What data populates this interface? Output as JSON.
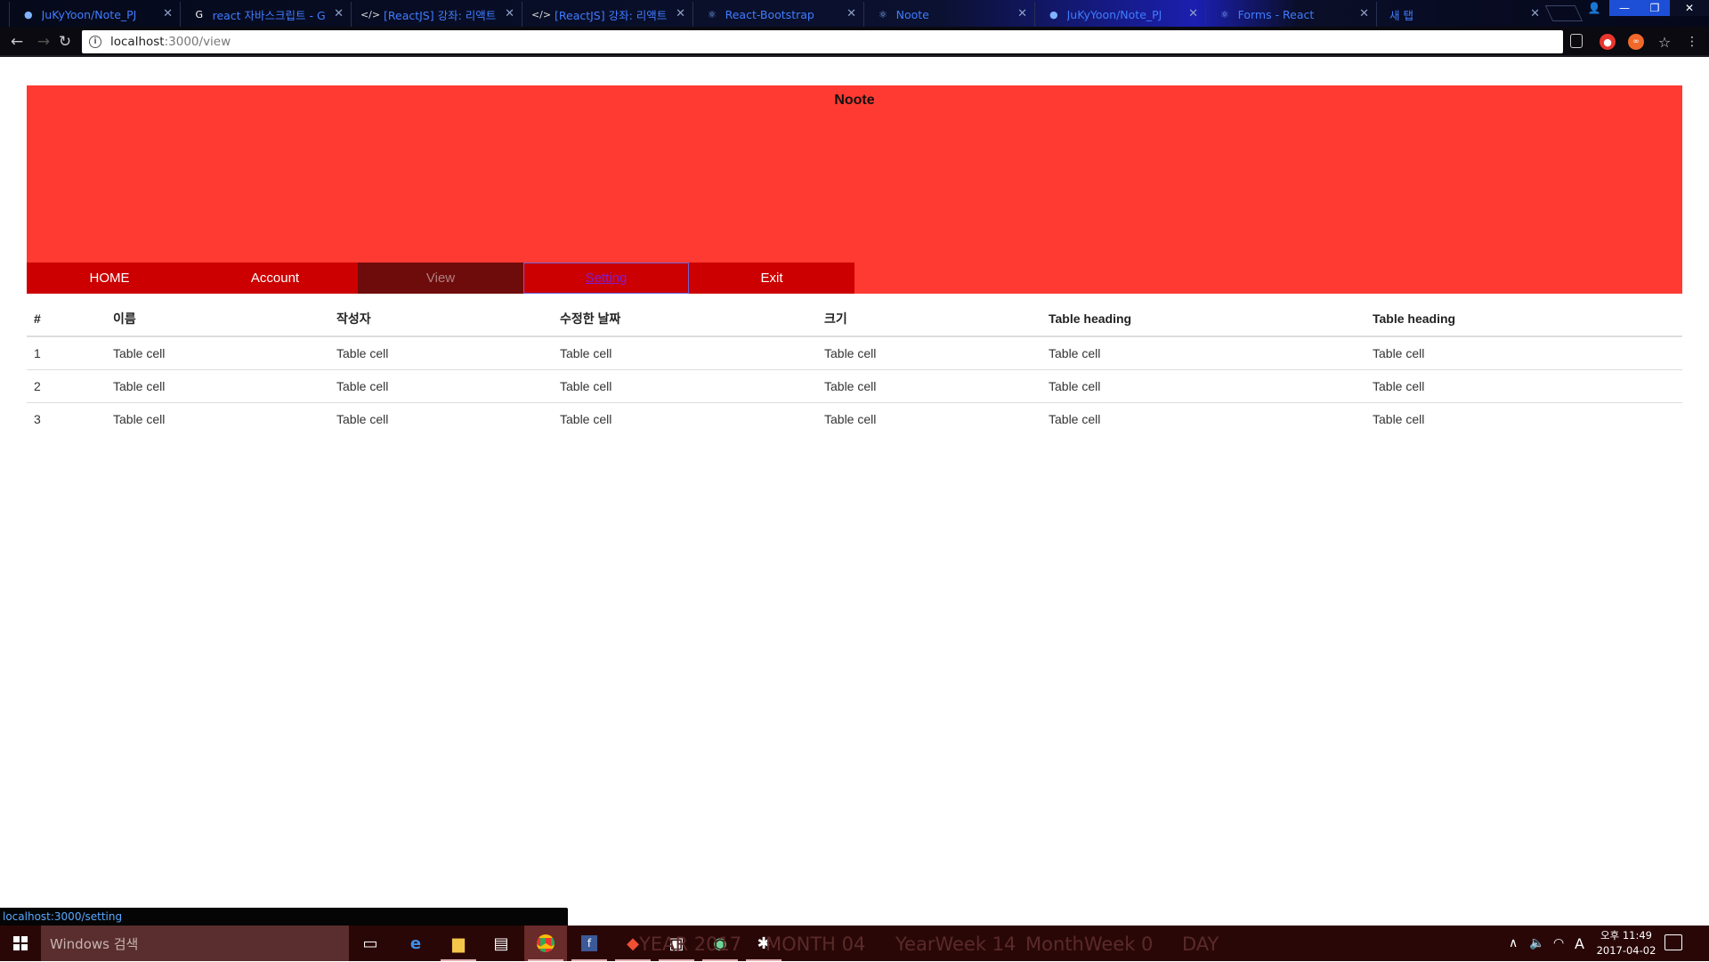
{
  "browser": {
    "tabs": [
      {
        "title": "JuKyYoon/Note_PJ",
        "favicon": "github-icon",
        "active": false
      },
      {
        "title": "react 자바스크립트 - G",
        "favicon": "google-icon",
        "active": false
      },
      {
        "title": "[ReactJS] 강좌: 리액트",
        "favicon": "velopert-icon",
        "active": false
      },
      {
        "title": "[ReactJS] 강좌: 리액트",
        "favicon": "velopert-icon",
        "active": false
      },
      {
        "title": "React-Bootstrap",
        "favicon": "react-icon",
        "active": false
      },
      {
        "title": "Noote",
        "favicon": "react-icon",
        "active": true
      },
      {
        "title": "JuKyYoon/Note_PJ",
        "favicon": "github-icon",
        "active": false
      },
      {
        "title": "Forms - React",
        "favicon": "react-icon",
        "active": false
      },
      {
        "title": "새 탭",
        "favicon": "",
        "active": false
      }
    ],
    "url_host": "localhost",
    "url_path": ":3000/view",
    "status_url": "localhost:3000/setting"
  },
  "page": {
    "title": "Noote",
    "menu": [
      {
        "label": "HOME"
      },
      {
        "label": "Account"
      },
      {
        "label": "View"
      },
      {
        "label": "Setting"
      },
      {
        "label": "Exit"
      }
    ],
    "table": {
      "headers": [
        "#",
        "이름",
        "작성자",
        "수정한 날짜",
        "크기",
        "Table heading",
        "Table heading"
      ],
      "rows": [
        [
          "1",
          "Table cell",
          "Table cell",
          "Table cell",
          "Table cell",
          "Table cell",
          "Table cell"
        ],
        [
          "2",
          "Table cell",
          "Table cell",
          "Table cell",
          "Table cell",
          "Table cell",
          "Table cell"
        ],
        [
          "3",
          "Table cell",
          "Table cell",
          "Table cell",
          "Table cell",
          "Table cell",
          "Table cell"
        ]
      ]
    }
  },
  "taskbar": {
    "search_placeholder": "Windows 검색",
    "overlay": {
      "year": "YEAR 2017",
      "month": "MONTH 04",
      "yearweek": "YearWeek 14",
      "monthweek": "MonthWeek 0",
      "day": "DAY"
    },
    "ime": "A",
    "clock_period": "오후 11:49",
    "clock_date": "2017-04-02"
  },
  "colors": {
    "header_bg": "#ff3a33",
    "menu_bg": "#cc0000",
    "menu_view_bg": "#6e0c0c"
  }
}
